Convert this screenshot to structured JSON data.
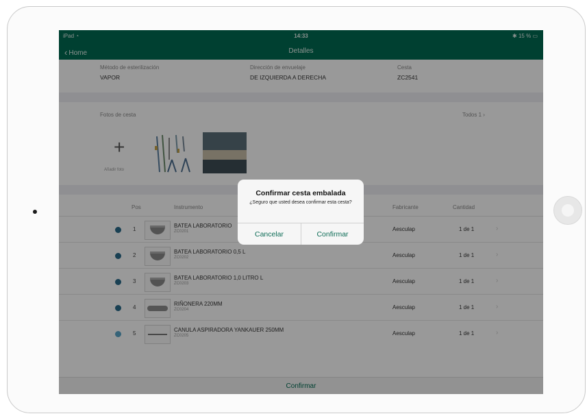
{
  "status": {
    "carrier": "iPad",
    "time": "14:33",
    "battery": "15 %"
  },
  "nav": {
    "back": "Home",
    "title": "Detalles"
  },
  "info": {
    "method_label": "Método de esterilización",
    "method_value": "VAPOR",
    "pack_label": "Dirección de envuelaje",
    "pack_value": "DE IZQUIERDA A DERECHA",
    "basket_label": "Cesta",
    "basket_value": "ZC2541"
  },
  "photos": {
    "label": "Fotos de cesta",
    "all": "Todos 1",
    "add_label": "Añadir foto"
  },
  "table": {
    "headers": {
      "pos": "Pos",
      "instrument": "Instrumento",
      "maker": "Fabricante",
      "qty": "Cantidad"
    },
    "rows": [
      {
        "pos": "1",
        "name": "BATEA LABORATORIO",
        "code": "ZC0201",
        "maker": "Aesculap",
        "qty": "1 de 1"
      },
      {
        "pos": "2",
        "name": "BATEA LABORATORIO 0,5 L",
        "code": "ZC0202",
        "maker": "Aesculap",
        "qty": "1 de 1"
      },
      {
        "pos": "3",
        "name": "BATEA LABORATORIO 1,0 LITRO L",
        "code": "ZC0203",
        "maker": "Aesculap",
        "qty": "1 de 1"
      },
      {
        "pos": "4",
        "name": "RIÑONERA 220MM",
        "code": "ZC0204",
        "maker": "Aesculap",
        "qty": "1 de 1"
      },
      {
        "pos": "5",
        "name": "CANULA ASPIRADORA YANKAUER 250MM",
        "code": "ZC0205",
        "maker": "Aesculap",
        "qty": "1 de 1"
      }
    ]
  },
  "footer": {
    "confirm": "Confirmar"
  },
  "alert": {
    "title": "Confirmar cesta embalada",
    "message": "¿Seguro que usted desea confirmar esta cesta?",
    "cancel": "Cancelar",
    "confirm": "Confirmar"
  },
  "colors": {
    "brand": "#006b52"
  }
}
